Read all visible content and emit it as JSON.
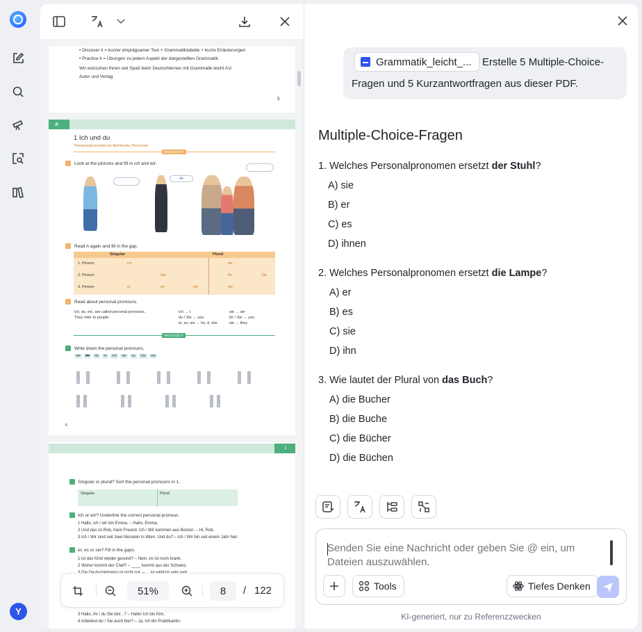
{
  "pdf_toolbar": {
    "sidebar_toggle": "sidebar-icon",
    "translate": "translate-icon",
    "dropdown": "chevron-down-icon",
    "download": "download-icon",
    "close": "close-icon"
  },
  "pdf_pages": {
    "page5": {
      "lines": [
        "•  Discover it = kurzer einprägsamer Text + Grammatiktabelle + kurze Erläuterungen",
        "•  Practice it = Übungen zu jedem Aspekt der dargestellten Grammatik.",
        "Wir wünschen Ihnen viel Spaß beim Deutschlernen mit Grammatik leicht A1!",
        "Autor und Verlag"
      ],
      "page_number": "5"
    },
    "page6": {
      "section_tag": "A",
      "chapter_title": "1  Ich und du",
      "chapter_sub": "Personalpronomen im Nominativ, Personen",
      "discover": "DISCOVER IT",
      "task_a": "Look at the pictures and fill in ich and wir.",
      "bubble_du": "du",
      "task_b": "Read A again and fill in the gap.",
      "table_singular": "Singular",
      "table_plural": "Plural",
      "rows": [
        "1. Person",
        "2. Person",
        "3. Person"
      ],
      "cells": [
        "ich",
        "wir",
        "Sie",
        "ihr",
        "Sie",
        "er",
        "es",
        "sie",
        "sie"
      ],
      "task_c": "Read about personal pronouns.",
      "c_left": [
        "ich, du, etc. are called personal pronouns.",
        "They refer to people:"
      ],
      "c_mid": [
        "ich → I",
        "du / Sie → you",
        "er, es, sie → he, it, she"
      ],
      "c_right": [
        "wir → we",
        "ihr / Sie → you",
        "sie → they"
      ],
      "practice": "PRACTICE IT",
      "task_1": "Write down the personal pronouns.",
      "word_chips": [
        "wir",
        "ihr",
        "du",
        "er",
        "ich",
        "sie",
        "es",
        "Sie",
        "sie"
      ],
      "page_number": "6"
    },
    "page7": {
      "page_number": "1",
      "task_2": "Singular or plural? Sort the personal pronouns in 1.",
      "singular": "Singular",
      "plural": "Plural",
      "task_3": "Ich or wir? Underline the correct personal pronoun.",
      "lines_3": [
        "1  Hallo, ich / wir bin Emma. – Hallo, Emma.",
        "2  Und das ist Rob, mein Freund. Ich / Wir kommen aus Boston. – Hi, Rob.",
        "3  Ich / Wir sind seit zwei Monaten in Wien. Und du? – Ich / Wir bin seit einem Jahr hier."
      ],
      "task_4": "er, es or sie? Fill in the gaps.",
      "lines_4": [
        "1  ist das Kind wieder gesund? – Nein, es ist noch krank.",
        "2  Woher kommt der Chef? – ____ kommt aus der Schweiz.",
        "3  Die Deutschlehrerin ist nicht gut. – ... ist wirklich sehr nett."
      ],
      "lines_5": [
        "3  Hallo, ihr / du Sie bist ..? – Hallo! Ich bin Kim.",
        "4  Arbeitest du / Sie auch hier? – Ja, ich bin Praktikantin."
      ]
    }
  },
  "zoombar": {
    "zoom": "51%",
    "page": "8",
    "separator": "/",
    "total": "122"
  },
  "rail": {
    "items": [
      "logo",
      "edit-icon",
      "search-icon",
      "telescope-icon",
      "scan-search-icon",
      "library-icon"
    ],
    "avatar": "Y"
  },
  "chat": {
    "file_chip": "Grammatik_leicht_...",
    "user_message_line1": "Erstelle 5 Multiple-Choice-",
    "user_message_line2": "Fragen und 5 Kurzantwortfragen aus dieser PDF.",
    "heading": "Multiple-Choice-Fragen",
    "questions": [
      {
        "pre": "1. Welches Personalpronomen ersetzt ",
        "bold": "der Stuhl",
        "post": "?",
        "options": [
          "A) sie",
          "B) er",
          "C) es",
          "D) ihnen"
        ]
      },
      {
        "pre": "2. Welches Personalpronomen ersetzt ",
        "bold": "die Lampe",
        "post": "?",
        "options": [
          "A) er",
          "B) es",
          "C) sie",
          "D) ihn"
        ]
      },
      {
        "pre": "3. Wie lautet der Plural von ",
        "bold": "das Buch",
        "post": "?",
        "options": [
          "A) die Bucher",
          "B) die Buche",
          "C) die Bücher",
          "D) die Büchen"
        ]
      }
    ],
    "composer_placeholder": "Senden Sie eine Nachricht oder geben Sie @ ein, um Dateien auszuwählen.",
    "tools_label": "Tools",
    "deep_think_label": "Tiefes Denken",
    "footnote": "KI-generiert, nur zu Referenzzwecken"
  }
}
